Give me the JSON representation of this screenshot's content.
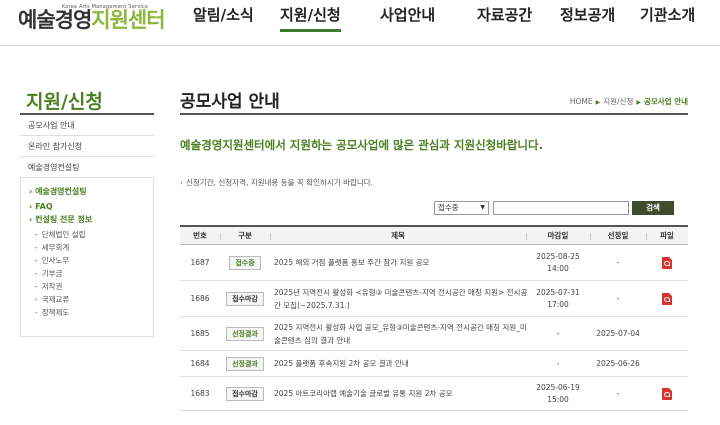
{
  "logo": {
    "sub": "Korea Arts Management Service",
    "main_a": "예술경영",
    "main_b": "지원센터"
  },
  "gnb": [
    "알림/소식",
    "지원/신청",
    "사업안내",
    "자료공간",
    "정보공개",
    "기관소개"
  ],
  "lnb": {
    "title": "지원/신청",
    "items": [
      "공모사업 안내",
      "온라인 참가신청",
      "예술경영컨설팅"
    ],
    "subs": [
      "예술경영컨설팅",
      "FAQ",
      "컨설팅 전문 정보"
    ],
    "leaves": [
      "단체법인 설립",
      "세무회계",
      "인사노무",
      "기부금",
      "저작권",
      "국제교류",
      "정책제도"
    ]
  },
  "page": {
    "title": "공모사업 안내",
    "breadcrumb": [
      "HOME",
      "지원/신청",
      "공모사업 안내"
    ],
    "lead": "예술경영지원센터에서 지원하는 공모사업에 많은 관심과 지원신청바랍니다.",
    "notice": "신청기간, 신청자격, 지원내용 등을 꼭 확인하시기 바랍니다."
  },
  "search": {
    "select_value": "접수중",
    "button": "검색"
  },
  "table": {
    "headers": [
      "번호",
      "구분",
      "제목",
      "마감일",
      "선정일",
      "파일"
    ],
    "rows": [
      {
        "no": "1687",
        "status": "접수중",
        "title": "2025 해외 거점 플랫폼 홍보 주간 참가 지원 공모",
        "deadline_date": "2025-08-25",
        "deadline_time": "14:00",
        "selected": "-"
      },
      {
        "no": "1686",
        "status": "접수마감",
        "title": "2025년 지역전시 활성화 <유형③ 미술콘텐츠-지역 전시공간 매칭 지원> 전시공간 모집(~2025.7.31.)",
        "deadline_date": "2025-07-31",
        "deadline_time": "17:00",
        "selected": "-"
      },
      {
        "no": "1685",
        "status": "선정결과",
        "title": "2025 지역전시 활성화 사업 공모_유형③미술콘텐츠-지역 전시공간 매칭 지원_미술콘텐츠 심의 결과 안내",
        "deadline_date": "-",
        "deadline_time": "",
        "selected": "2025-07-04"
      },
      {
        "no": "1684",
        "status": "선정결과",
        "title": "2025 플랫폼 후속지원 2차 공모 결과 안내",
        "deadline_date": "-",
        "deadline_time": "",
        "selected": "2025-06-26"
      },
      {
        "no": "1683",
        "status": "접수마감",
        "title": "2025 아트코리아랩 예술기술 글로벌 유통 지원 2차 공모",
        "deadline_date": "2025-06-19",
        "deadline_time": "15:00",
        "selected": "-"
      }
    ]
  }
}
